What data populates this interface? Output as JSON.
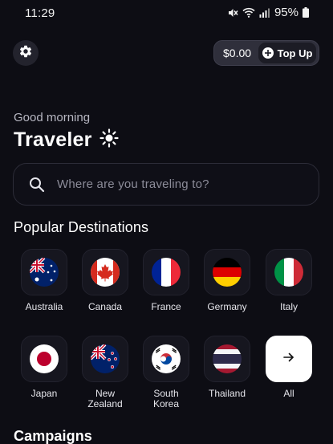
{
  "status_bar": {
    "time": "11:29",
    "battery": "95%",
    "icons": [
      "mute-icon",
      "wifi-icon",
      "signal-icon",
      "battery-icon"
    ]
  },
  "header": {
    "settings_icon": "gear-icon",
    "balance": "$0.00",
    "topup_label": "Top Up",
    "topup_icon": "plus-circle-icon"
  },
  "greeting": {
    "salutation": "Good morning",
    "name": "Traveler",
    "icon": "sun-icon"
  },
  "search": {
    "placeholder": "Where are you traveling to?"
  },
  "popular": {
    "title": "Popular Destinations",
    "items": [
      {
        "label": "Australia",
        "icon": "australia-flag-icon"
      },
      {
        "label": "Canada",
        "icon": "canada-flag-icon"
      },
      {
        "label": "France",
        "icon": "france-flag-icon"
      },
      {
        "label": "Germany",
        "icon": "germany-flag-icon"
      },
      {
        "label": "Italy",
        "icon": "italy-flag-icon"
      },
      {
        "label": "Japan",
        "icon": "japan-flag-icon"
      },
      {
        "label": "New\nZealand",
        "icon": "new-zealand-flag-icon"
      },
      {
        "label": "South\nKorea",
        "icon": "south-korea-flag-icon"
      },
      {
        "label": "Thailand",
        "icon": "thailand-flag-icon"
      },
      {
        "label": "All",
        "icon": "arrow-right-icon"
      }
    ]
  },
  "campaigns": {
    "title": "Campaigns"
  },
  "colors": {
    "background": "#0d0d14",
    "tile": "#16161f",
    "muted_text": "#8c8c99"
  }
}
